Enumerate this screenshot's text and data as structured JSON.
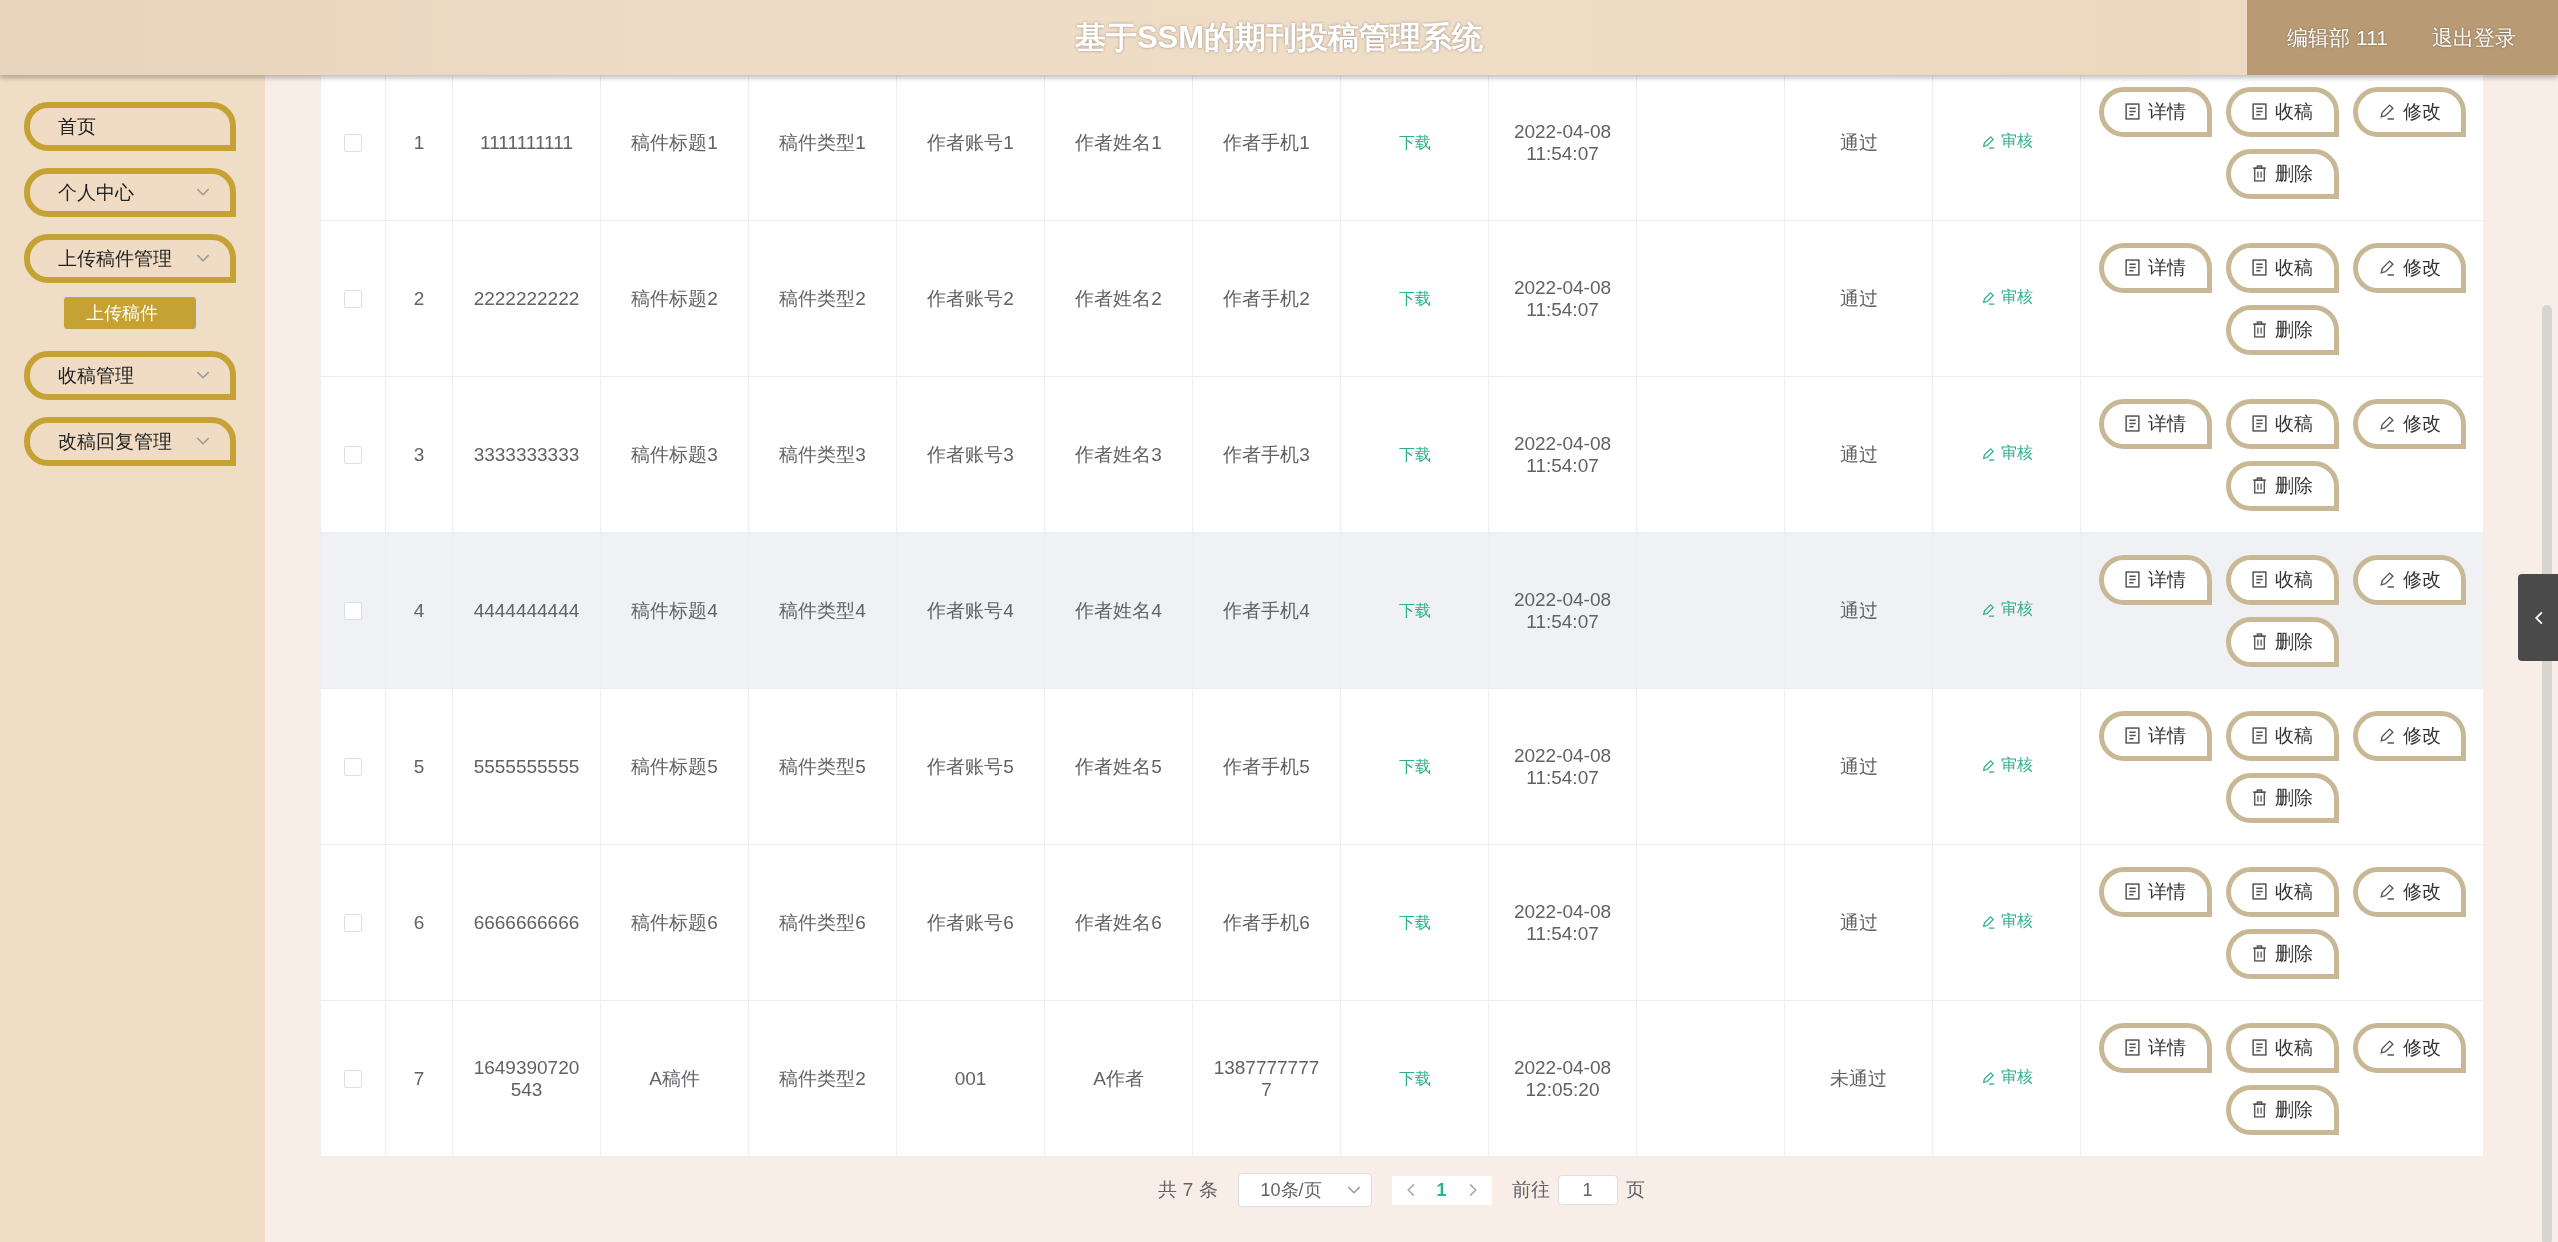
{
  "header": {
    "title": "基于SSM的期刊投稿管理系统",
    "user": "编辑部 111",
    "logout": "退出登录"
  },
  "sidebar": {
    "items": [
      {
        "kind": "link",
        "label": "首页"
      },
      {
        "kind": "submenu",
        "label": "个人中心"
      },
      {
        "kind": "submenu",
        "label": "上传稿件管理",
        "children": [
          {
            "label": "上传稿件",
            "selected": true
          }
        ]
      },
      {
        "kind": "submenu",
        "label": "收稿管理"
      },
      {
        "kind": "submenu",
        "label": "改稿回复管理"
      }
    ]
  },
  "table": {
    "rows": [
      {
        "checked": false,
        "highlighted": false,
        "index": "1",
        "cells": [
          "1111111111",
          "稿件标题1",
          "稿件类型1",
          "作者账号1",
          "作者姓名1",
          "作者手机1"
        ],
        "download": "下载",
        "date": "2022-04-08 11:54:07",
        "status": "通过",
        "review": "审核",
        "actions": [
          {
            "kind": "doc",
            "label": "详情"
          },
          {
            "kind": "doc",
            "label": "收稿"
          },
          {
            "kind": "pencil",
            "label": "修改"
          },
          {
            "kind": "trash",
            "label": "删除"
          }
        ]
      },
      {
        "checked": false,
        "highlighted": false,
        "index": "2",
        "cells": [
          "2222222222",
          "稿件标题2",
          "稿件类型2",
          "作者账号2",
          "作者姓名2",
          "作者手机2"
        ],
        "download": "下载",
        "date": "2022-04-08 11:54:07",
        "status": "通过",
        "review": "审核",
        "actions": [
          {
            "kind": "doc",
            "label": "详情"
          },
          {
            "kind": "doc",
            "label": "收稿"
          },
          {
            "kind": "pencil",
            "label": "修改"
          },
          {
            "kind": "trash",
            "label": "删除"
          }
        ]
      },
      {
        "checked": false,
        "highlighted": false,
        "index": "3",
        "cells": [
          "3333333333",
          "稿件标题3",
          "稿件类型3",
          "作者账号3",
          "作者姓名3",
          "作者手机3"
        ],
        "download": "下载",
        "date": "2022-04-08 11:54:07",
        "status": "通过",
        "review": "审核",
        "actions": [
          {
            "kind": "doc",
            "label": "详情"
          },
          {
            "kind": "doc",
            "label": "收稿"
          },
          {
            "kind": "pencil",
            "label": "修改"
          },
          {
            "kind": "trash",
            "label": "删除"
          }
        ]
      },
      {
        "checked": false,
        "highlighted": true,
        "index": "4",
        "cells": [
          "4444444444",
          "稿件标题4",
          "稿件类型4",
          "作者账号4",
          "作者姓名4",
          "作者手机4"
        ],
        "download": "下载",
        "date": "2022-04-08 11:54:07",
        "status": "通过",
        "review": "审核",
        "actions": [
          {
            "kind": "doc",
            "label": "详情"
          },
          {
            "kind": "doc",
            "label": "收稿"
          },
          {
            "kind": "pencil",
            "label": "修改"
          },
          {
            "kind": "trash",
            "label": "删除"
          }
        ]
      },
      {
        "checked": false,
        "highlighted": false,
        "index": "5",
        "cells": [
          "5555555555",
          "稿件标题5",
          "稿件类型5",
          "作者账号5",
          "作者姓名5",
          "作者手机5"
        ],
        "download": "下载",
        "date": "2022-04-08 11:54:07",
        "status": "通过",
        "review": "审核",
        "actions": [
          {
            "kind": "doc",
            "label": "详情"
          },
          {
            "kind": "doc",
            "label": "收稿"
          },
          {
            "kind": "pencil",
            "label": "修改"
          },
          {
            "kind": "trash",
            "label": "删除"
          }
        ]
      },
      {
        "checked": false,
        "highlighted": false,
        "index": "6",
        "cells": [
          "6666666666",
          "稿件标题6",
          "稿件类型6",
          "作者账号6",
          "作者姓名6",
          "作者手机6"
        ],
        "download": "下载",
        "date": "2022-04-08 11:54:07",
        "status": "通过",
        "review": "审核",
        "actions": [
          {
            "kind": "doc",
            "label": "详情"
          },
          {
            "kind": "doc",
            "label": "收稿"
          },
          {
            "kind": "pencil",
            "label": "修改"
          },
          {
            "kind": "trash",
            "label": "删除"
          }
        ]
      },
      {
        "checked": false,
        "highlighted": false,
        "index": "7",
        "cells": [
          "1649390720543",
          "A稿件",
          "稿件类型2",
          "001",
          "A作者",
          "13877777777"
        ],
        "download": "下载",
        "date": "2022-04-08 12:05:20",
        "status": "未通过",
        "review": "审核",
        "actions": [
          {
            "kind": "doc",
            "label": "详情"
          },
          {
            "kind": "doc",
            "label": "收稿"
          },
          {
            "kind": "pencil",
            "label": "修改"
          },
          {
            "kind": "trash",
            "label": "删除"
          }
        ]
      }
    ]
  },
  "pagination": {
    "total": "共 7 条",
    "page_size": "10条/页",
    "pages": [
      {
        "label": "1",
        "selected": true
      }
    ],
    "goto_label": "前往",
    "goto_value": "1",
    "goto_suffix": "页"
  }
}
